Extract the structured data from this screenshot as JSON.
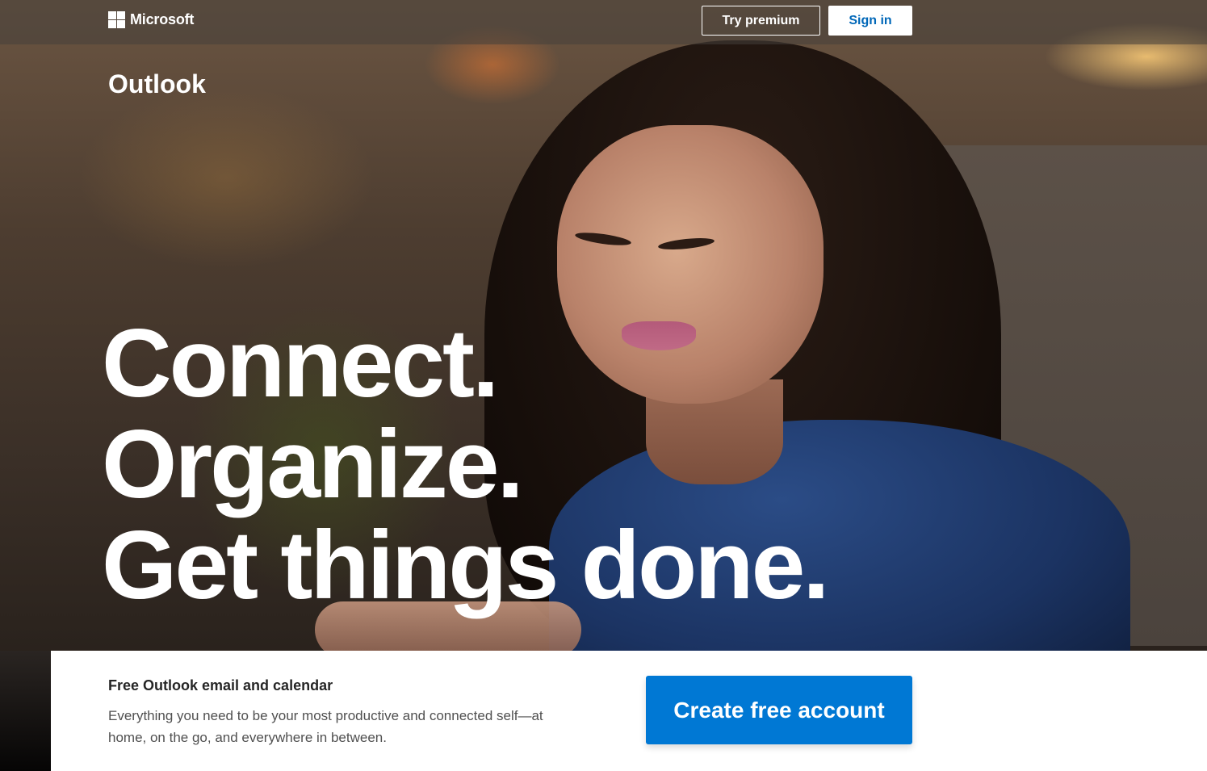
{
  "header": {
    "brand": "Microsoft",
    "try_premium_label": "Try premium",
    "sign_in_label": "Sign in"
  },
  "product": {
    "title": "Outlook"
  },
  "hero": {
    "headline_lines": [
      "Connect.",
      "Organize.",
      "Get things done."
    ]
  },
  "card": {
    "title": "Free Outlook email and calendar",
    "description": "Everything you need to be your most productive and connected self—at home, on the go, and everywhere in between.",
    "cta_label": "Create free account"
  },
  "icons": {
    "logo": "microsoft-logo-icon"
  },
  "colors": {
    "accent": "#0078d4",
    "signin_text": "#0067b8"
  }
}
